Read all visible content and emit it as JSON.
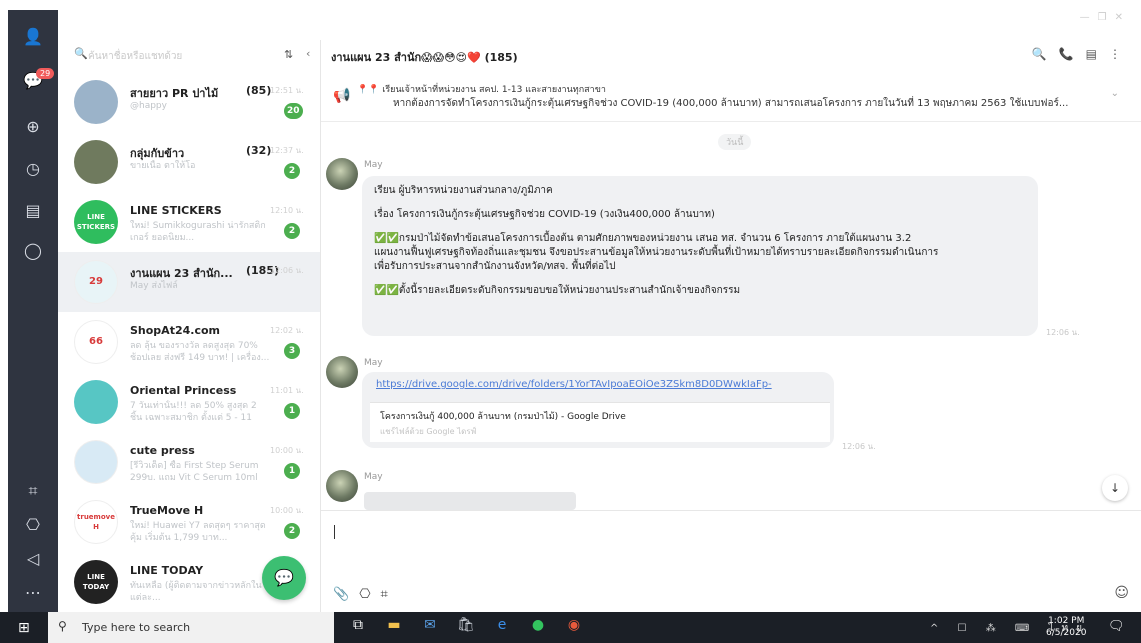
{
  "window": {
    "controls": [
      "—",
      "❐",
      "✕"
    ]
  },
  "sidebar": {
    "icons": [
      "person-icon",
      "chat-icon",
      "add-friend-icon",
      "clock-icon",
      "note-icon",
      "line-icon",
      "crop-icon",
      "bookmark-icon",
      "speaker-icon",
      "more-icon"
    ],
    "chat_badge": "29"
  },
  "chat_list": {
    "search_placeholder": "ค้นหาชื่อหรือแชทด้วย",
    "items": [
      {
        "name": "สายยาว PR ปาไม้",
        "count": "(85)",
        "preview": "@happy",
        "time": "12:51 น.",
        "badge": "20",
        "avatar_color": "#9bb3c9",
        "avatar_text": ""
      },
      {
        "name": "กลุ่มกับข้าว",
        "count": "(32)",
        "preview": "ขายเนื้อ ตาให้โอ",
        "time": "12:37 น.",
        "badge": "2",
        "avatar_color": "#6f7a5e",
        "avatar_text": ""
      },
      {
        "name": "LINE STICKERS",
        "count": "",
        "preview": "ใหม่! Sumikkogurashi น่ารักสติกเกอร์ ยอดนิยม...",
        "time": "12:10 น.",
        "badge": "2",
        "avatar_color": "#2fbd5e",
        "avatar_text": "LINE STICKERS"
      },
      {
        "name": "งานแผน 23 สำนัก...",
        "count": "(185)",
        "preview": "May ส่งไฟล์",
        "time": "12:06 น.",
        "badge": "",
        "avatar_color": "#e8f4f7",
        "avatar_text": "29"
      },
      {
        "name": "ShopAt24.com",
        "count": "",
        "preview": "ลด ลุ้น ของรางวัล ลดสูงสุด 70% ช้อปเลย ส่งฟรี 149 บาท! | เครื่อง...",
        "time": "12:02 น.",
        "badge": "3",
        "avatar_color": "#ffffff",
        "avatar_text": "66"
      },
      {
        "name": "Oriental Princess",
        "count": "",
        "preview": "7 วันเท่านั้น!!! ลด 50% สูงสุด 2 ชิ้น เฉพาะสมาชิก ตั้งแต่ 5 - 11 มิ.ย. 6...",
        "time": "11:01 น.",
        "badge": "1",
        "avatar_color": "#57c6c4",
        "avatar_text": ""
      },
      {
        "name": "cute press",
        "count": "",
        "preview": "[รีวิวเด็ด] ซื้อ First Step Serum 299บ. แถม Vit C Serum 10ml มูล...",
        "time": "10:00 น.",
        "badge": "1",
        "avatar_color": "#d8eaf5",
        "avatar_text": ""
      },
      {
        "name": "TrueMove H",
        "count": "",
        "preview": "ใหม่! Huawei Y7 ลดสุดๆ ราคาสุดคุ้ม เริ่มต้น 1,799 บาท...",
        "time": "10:00 น.",
        "badge": "2",
        "avatar_color": "#ffffff",
        "avatar_text": "truemove H"
      },
      {
        "name": "LINE TODAY",
        "count": "",
        "preview": "ทันเหลือ (ผู้ติดตามจากข่าวหลักในแต่ละ...",
        "time": "",
        "badge": "",
        "avatar_color": "#222222",
        "avatar_text": "LINE TODAY"
      }
    ]
  },
  "chat": {
    "title": "งานแผน 23 สำนัก😱😱😳😍❤️",
    "member_count": "(185)",
    "header_tools": [
      "search-icon",
      "call-icon",
      "notes-icon",
      "menu-icon"
    ],
    "announcement": {
      "line1": "📍📍 เรียนเจ้าหน้าที่หน่วยงาน สคป. 1-13 และสายงานทุกสาขา",
      "line2": "หากต้องการจัดทำโครงการเงินกู้กระตุ้นเศรษฐกิจช่วง COVID-19 (400,000 ล้านบาท) สามารถเสนอโครงการ ภายในวันที่ 13 พฤษภาคม 2563 ใช้แบบฟอร์..."
    },
    "date_chip": "วันนี้",
    "messages": [
      {
        "sender": "May",
        "lines": [
          "เรียน ผู้บริหารหน่วยงานส่วนกลาง/ภูมิภาค",
          "",
          "เรื่อง โครงการเงินกู้กระตุ้นเศรษฐกิจช่วย COVID-19 (วงเงิน400,000 ล้านบาท)",
          "",
          "✅✅กรมป่าไม้จัดทำข้อเสนอโครงการเบื้องต้น ตามศักยภาพของหน่วยงาน เสนอ ทส. จำนวน 6 โครงการ ภายใต้แผนงาน 3.2",
          "แผนงานฟื้นฟูเศรษฐกิจท้องถิ่นและชุมชน จึงขอประสานข้อมูลให้หน่วยงานระดับพื้นที่เป้าหมายได้ทราบรายละเอียดกิจกรรมดำเนินการ",
          "เพื่อรับการประสานจากสำนักงานจังหวัด/ทสจ. พื้นที่ต่อไป",
          "",
          "✅✅ตั้งนี้รายละเอียดระดับกิจกรรมขอบขอให้หน่วยงานประสานสำนักเจ้าของกิจกรรม"
        ],
        "time": "12:06 น."
      },
      {
        "sender": "May",
        "link": "https://drive.google.com/drive/folders/1YorTAvIpoaEOiOe3ZSkm8D0DWwkIaFp-",
        "card_title": "โครงการเงินกู้ 400,000 ล้านบาท (กรมป่าไม้) - Google Drive",
        "card_sub": "แชร์ไฟล์ด้วย Google ไดรฟ์",
        "time": "12:06 น."
      },
      {
        "sender": "May",
        "time": ""
      }
    ],
    "input_tools": [
      "attach-icon",
      "bookmark-icon",
      "crop-icon"
    ],
    "scroll_down": "↓"
  },
  "taskbar": {
    "search_text": "Type here to search",
    "apps": [
      "task-view-icon",
      "file-explorer-icon",
      "mail-icon",
      "store-icon",
      "edge-icon",
      "line-app-icon",
      "chrome-icon"
    ],
    "tray": "^ ☐ ⁂ ⌨ ไทย",
    "time": "1:02 PM",
    "date": "6/5/2020"
  }
}
